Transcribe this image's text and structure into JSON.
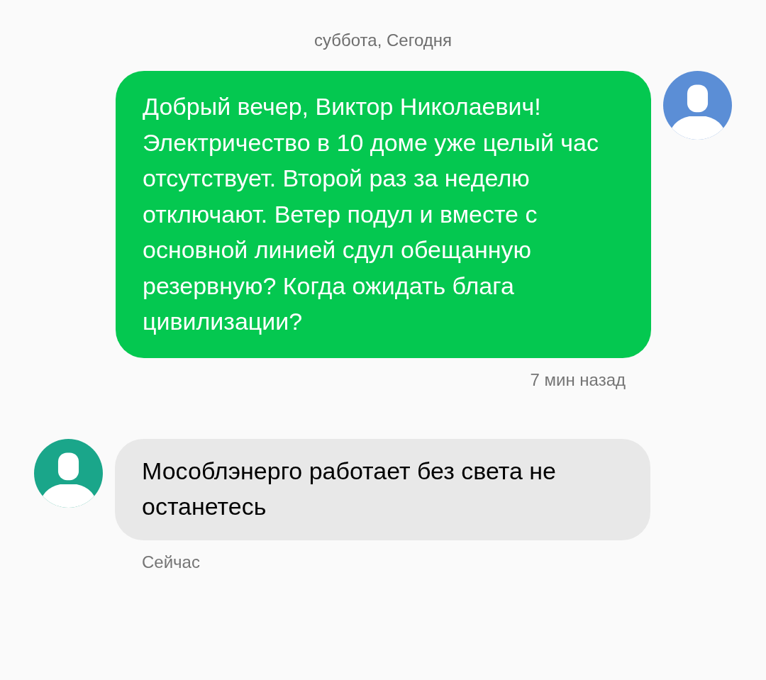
{
  "date_header": "суббота, Сегодня",
  "messages": [
    {
      "kind": "outgoing",
      "color": "#5b8ed6",
      "text": "Добрый вечер, Виктор Николаевич! Электричество в 10 доме уже целый час отсутствует. Второй раз за неделю отключают. Ветер подул и вместе с основной линией сдул обещанную резервную? Когда ожидать блага цивилизации?",
      "time": "7 мин назад"
    },
    {
      "kind": "incoming",
      "color": "#1aa68a",
      "text": "Мособлэнерго работает без света не останетесь",
      "time": "Сейчас"
    }
  ]
}
